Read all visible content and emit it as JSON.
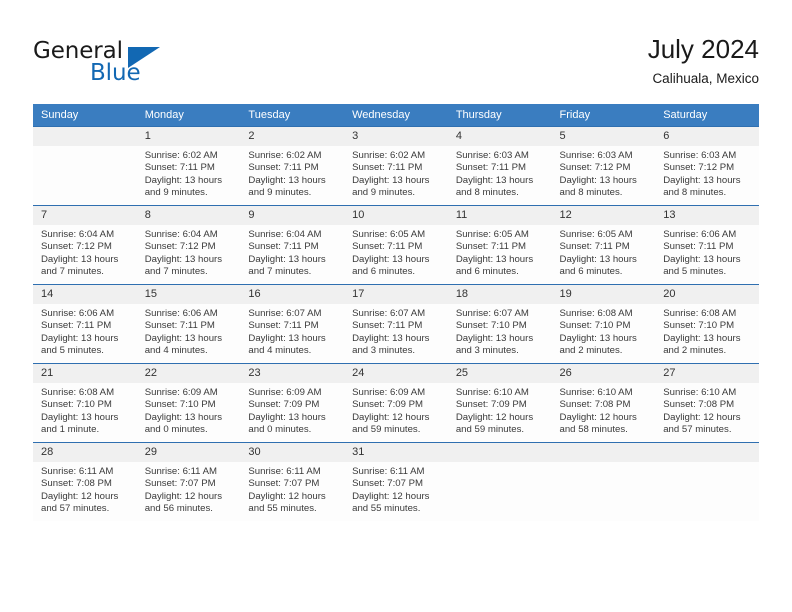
{
  "brand": {
    "name_part1": "General",
    "name_part2": "Blue",
    "accent_color": "#1268b3"
  },
  "header": {
    "title": "July 2024",
    "subtitle": "Calihuala, Mexico"
  },
  "theme": {
    "header_row_bg": "#3a7dc0",
    "row_divider": "#2f6fb0",
    "daynum_band_bg": "#f0f0f0"
  },
  "weekday_headers": [
    "Sunday",
    "Monday",
    "Tuesday",
    "Wednesday",
    "Thursday",
    "Friday",
    "Saturday"
  ],
  "weeks": [
    [
      {
        "day": "",
        "lines": []
      },
      {
        "day": "1",
        "lines": [
          "Sunrise: 6:02 AM",
          "Sunset: 7:11 PM",
          "Daylight: 13 hours",
          "and 9 minutes."
        ]
      },
      {
        "day": "2",
        "lines": [
          "Sunrise: 6:02 AM",
          "Sunset: 7:11 PM",
          "Daylight: 13 hours",
          "and 9 minutes."
        ]
      },
      {
        "day": "3",
        "lines": [
          "Sunrise: 6:02 AM",
          "Sunset: 7:11 PM",
          "Daylight: 13 hours",
          "and 9 minutes."
        ]
      },
      {
        "day": "4",
        "lines": [
          "Sunrise: 6:03 AM",
          "Sunset: 7:11 PM",
          "Daylight: 13 hours",
          "and 8 minutes."
        ]
      },
      {
        "day": "5",
        "lines": [
          "Sunrise: 6:03 AM",
          "Sunset: 7:12 PM",
          "Daylight: 13 hours",
          "and 8 minutes."
        ]
      },
      {
        "day": "6",
        "lines": [
          "Sunrise: 6:03 AM",
          "Sunset: 7:12 PM",
          "Daylight: 13 hours",
          "and 8 minutes."
        ]
      }
    ],
    [
      {
        "day": "7",
        "lines": [
          "Sunrise: 6:04 AM",
          "Sunset: 7:12 PM",
          "Daylight: 13 hours",
          "and 7 minutes."
        ]
      },
      {
        "day": "8",
        "lines": [
          "Sunrise: 6:04 AM",
          "Sunset: 7:12 PM",
          "Daylight: 13 hours",
          "and 7 minutes."
        ]
      },
      {
        "day": "9",
        "lines": [
          "Sunrise: 6:04 AM",
          "Sunset: 7:11 PM",
          "Daylight: 13 hours",
          "and 7 minutes."
        ]
      },
      {
        "day": "10",
        "lines": [
          "Sunrise: 6:05 AM",
          "Sunset: 7:11 PM",
          "Daylight: 13 hours",
          "and 6 minutes."
        ]
      },
      {
        "day": "11",
        "lines": [
          "Sunrise: 6:05 AM",
          "Sunset: 7:11 PM",
          "Daylight: 13 hours",
          "and 6 minutes."
        ]
      },
      {
        "day": "12",
        "lines": [
          "Sunrise: 6:05 AM",
          "Sunset: 7:11 PM",
          "Daylight: 13 hours",
          "and 6 minutes."
        ]
      },
      {
        "day": "13",
        "lines": [
          "Sunrise: 6:06 AM",
          "Sunset: 7:11 PM",
          "Daylight: 13 hours",
          "and 5 minutes."
        ]
      }
    ],
    [
      {
        "day": "14",
        "lines": [
          "Sunrise: 6:06 AM",
          "Sunset: 7:11 PM",
          "Daylight: 13 hours",
          "and 5 minutes."
        ]
      },
      {
        "day": "15",
        "lines": [
          "Sunrise: 6:06 AM",
          "Sunset: 7:11 PM",
          "Daylight: 13 hours",
          "and 4 minutes."
        ]
      },
      {
        "day": "16",
        "lines": [
          "Sunrise: 6:07 AM",
          "Sunset: 7:11 PM",
          "Daylight: 13 hours",
          "and 4 minutes."
        ]
      },
      {
        "day": "17",
        "lines": [
          "Sunrise: 6:07 AM",
          "Sunset: 7:11 PM",
          "Daylight: 13 hours",
          "and 3 minutes."
        ]
      },
      {
        "day": "18",
        "lines": [
          "Sunrise: 6:07 AM",
          "Sunset: 7:10 PM",
          "Daylight: 13 hours",
          "and 3 minutes."
        ]
      },
      {
        "day": "19",
        "lines": [
          "Sunrise: 6:08 AM",
          "Sunset: 7:10 PM",
          "Daylight: 13 hours",
          "and 2 minutes."
        ]
      },
      {
        "day": "20",
        "lines": [
          "Sunrise: 6:08 AM",
          "Sunset: 7:10 PM",
          "Daylight: 13 hours",
          "and 2 minutes."
        ]
      }
    ],
    [
      {
        "day": "21",
        "lines": [
          "Sunrise: 6:08 AM",
          "Sunset: 7:10 PM",
          "Daylight: 13 hours",
          "and 1 minute."
        ]
      },
      {
        "day": "22",
        "lines": [
          "Sunrise: 6:09 AM",
          "Sunset: 7:10 PM",
          "Daylight: 13 hours",
          "and 0 minutes."
        ]
      },
      {
        "day": "23",
        "lines": [
          "Sunrise: 6:09 AM",
          "Sunset: 7:09 PM",
          "Daylight: 13 hours",
          "and 0 minutes."
        ]
      },
      {
        "day": "24",
        "lines": [
          "Sunrise: 6:09 AM",
          "Sunset: 7:09 PM",
          "Daylight: 12 hours",
          "and 59 minutes."
        ]
      },
      {
        "day": "25",
        "lines": [
          "Sunrise: 6:10 AM",
          "Sunset: 7:09 PM",
          "Daylight: 12 hours",
          "and 59 minutes."
        ]
      },
      {
        "day": "26",
        "lines": [
          "Sunrise: 6:10 AM",
          "Sunset: 7:08 PM",
          "Daylight: 12 hours",
          "and 58 minutes."
        ]
      },
      {
        "day": "27",
        "lines": [
          "Sunrise: 6:10 AM",
          "Sunset: 7:08 PM",
          "Daylight: 12 hours",
          "and 57 minutes."
        ]
      }
    ],
    [
      {
        "day": "28",
        "lines": [
          "Sunrise: 6:11 AM",
          "Sunset: 7:08 PM",
          "Daylight: 12 hours",
          "and 57 minutes."
        ]
      },
      {
        "day": "29",
        "lines": [
          "Sunrise: 6:11 AM",
          "Sunset: 7:07 PM",
          "Daylight: 12 hours",
          "and 56 minutes."
        ]
      },
      {
        "day": "30",
        "lines": [
          "Sunrise: 6:11 AM",
          "Sunset: 7:07 PM",
          "Daylight: 12 hours",
          "and 55 minutes."
        ]
      },
      {
        "day": "31",
        "lines": [
          "Sunrise: 6:11 AM",
          "Sunset: 7:07 PM",
          "Daylight: 12 hours",
          "and 55 minutes."
        ]
      },
      {
        "day": "",
        "lines": []
      },
      {
        "day": "",
        "lines": []
      },
      {
        "day": "",
        "lines": []
      }
    ]
  ]
}
